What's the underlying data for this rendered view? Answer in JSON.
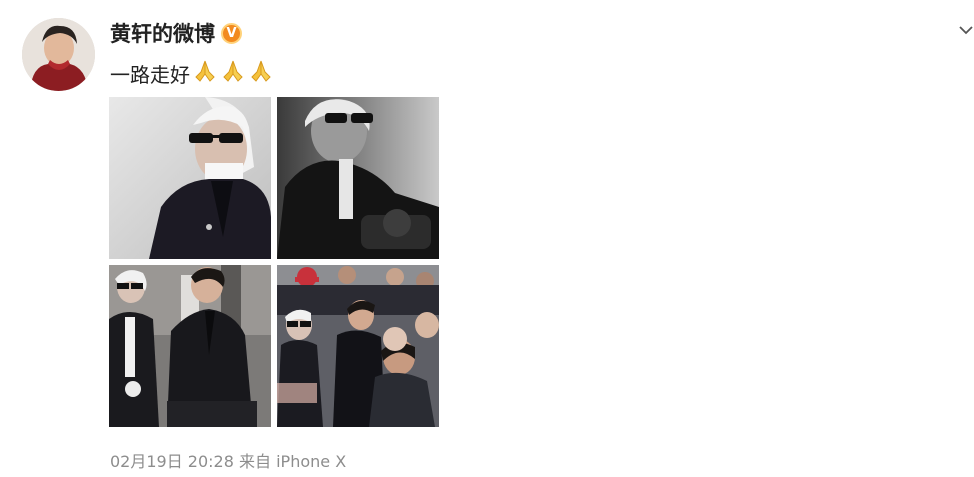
{
  "post": {
    "author": "黄轩的微博",
    "verified_badge": "V",
    "text": "一路走好",
    "emoji": [
      "pray-emoji",
      "pray-emoji",
      "pray-emoji"
    ],
    "timestamp": "02月19日 20:28",
    "source": "来自 iPhone X",
    "colors": {
      "name": "#222222",
      "meta": "#8d8d8d",
      "badge": "#f28a1f"
    }
  }
}
